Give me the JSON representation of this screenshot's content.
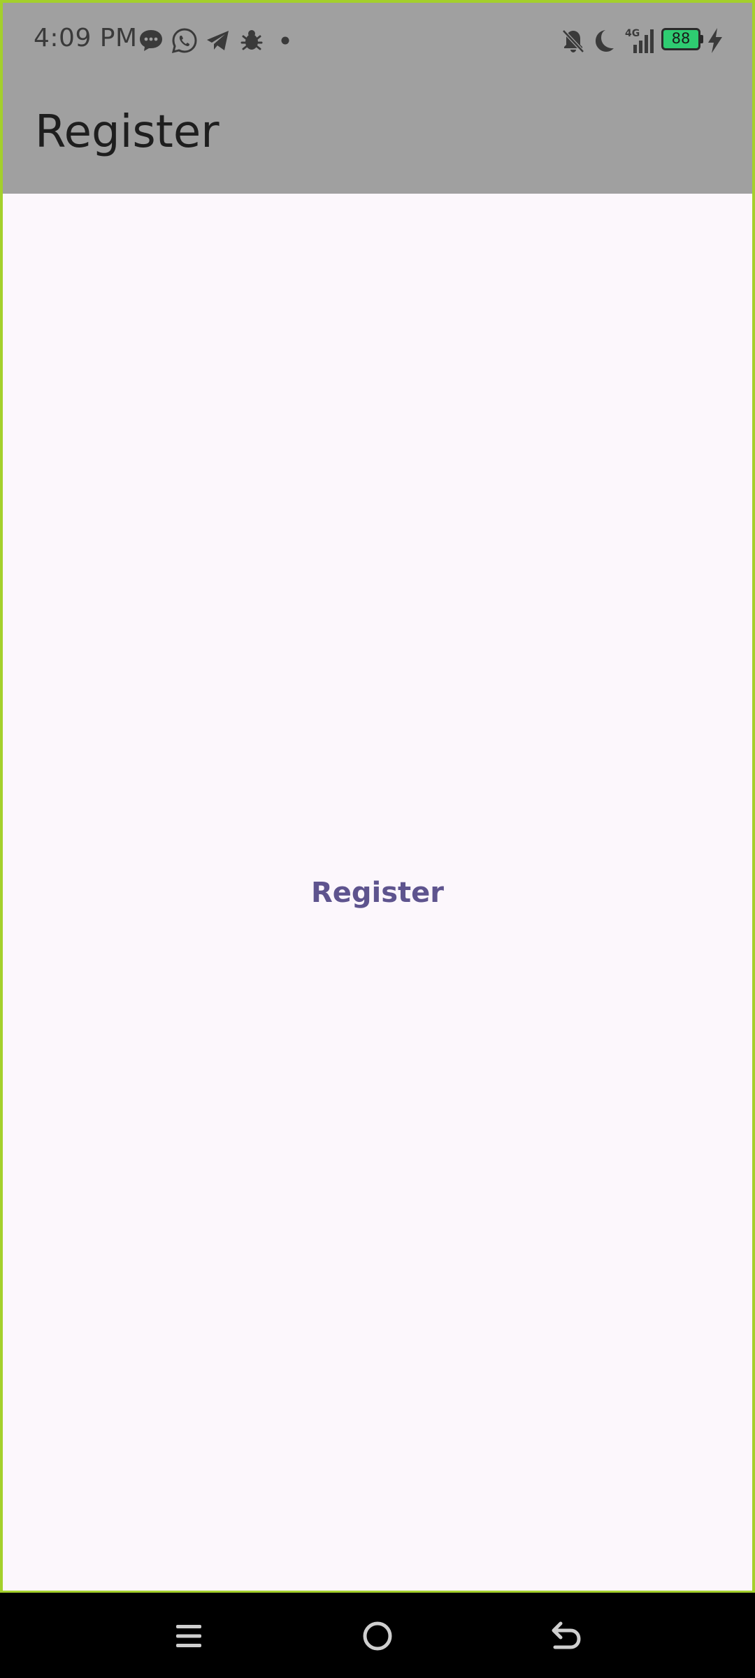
{
  "status_bar": {
    "time": "4:09 PM",
    "network_type": "4G",
    "battery_level": "88",
    "notification_icons": [
      "message-bubble-icon",
      "whatsapp-icon",
      "telegram-icon",
      "bug-icon",
      "dot-icon"
    ],
    "system_icons": [
      "bell-off-icon",
      "moon-icon",
      "signal-icon",
      "battery-icon",
      "charging-bolt-icon"
    ]
  },
  "app_bar": {
    "title": "Register"
  },
  "main": {
    "register_label": "Register"
  },
  "nav_bar": {
    "buttons": [
      "menu-icon",
      "home-icon",
      "back-icon"
    ]
  },
  "colors": {
    "app_bar_bg": "#a0a0a0",
    "content_bg": "#fcf7fc",
    "accent_text": "#5e548e",
    "frame_border": "#a4d02c",
    "battery_fill": "#2ecc71"
  }
}
